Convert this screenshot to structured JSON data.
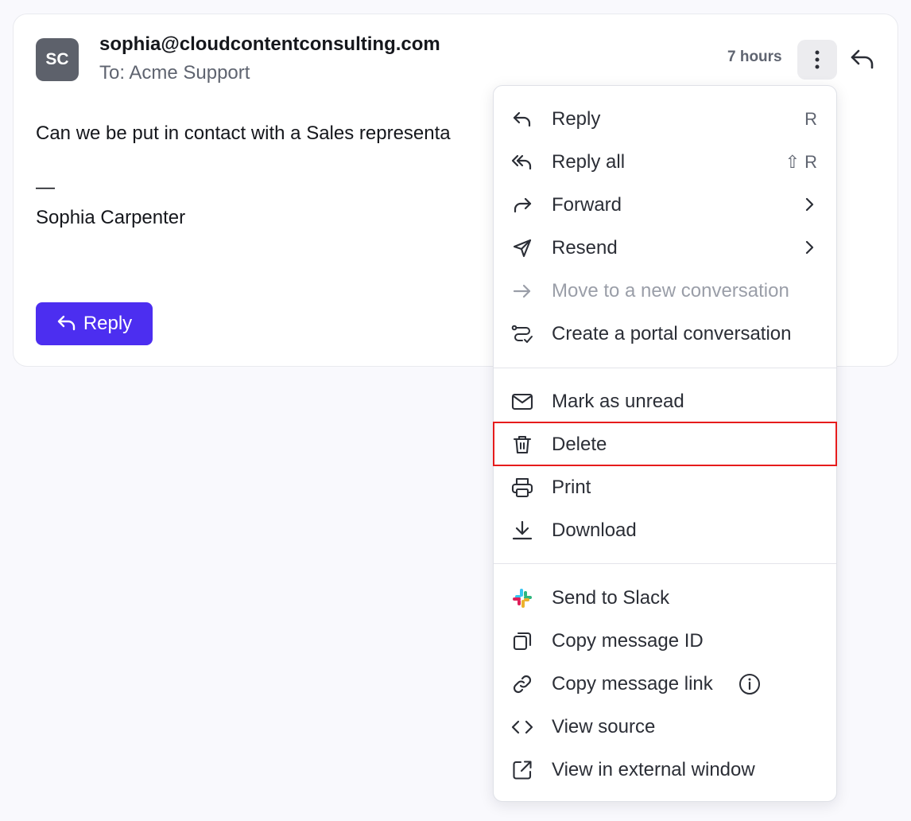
{
  "message": {
    "avatar_initials": "SC",
    "from": "sophia@cloudcontentconsulting.com",
    "to": "To: Acme Support",
    "time": "7 hours",
    "body": "Can we be put in contact with a Sales representa",
    "sig_dash": "—",
    "sig_name": "Sophia Carpenter",
    "reply_button": "Reply"
  },
  "menu": {
    "items": [
      {
        "label": "Reply",
        "shortcut": "R",
        "icon": "reply-icon"
      },
      {
        "label": "Reply all",
        "shortcut": "R",
        "shortcut_modifier": "⇧",
        "icon": "reply-all-icon"
      },
      {
        "label": "Forward",
        "icon": "forward-icon"
      },
      {
        "label": "Resend",
        "icon": "send-icon"
      },
      {
        "label": "Move to a new conversation",
        "icon": "arrow-right-icon",
        "disabled": true
      },
      {
        "label": "Create a portal conversation",
        "icon": "portal-icon"
      },
      {
        "label": "Mark as unread",
        "icon": "envelope-icon"
      },
      {
        "label": "Delete",
        "icon": "trash-icon"
      },
      {
        "label": "Print",
        "icon": "printer-icon"
      },
      {
        "label": "Download",
        "icon": "download-icon"
      },
      {
        "label": "Send to Slack",
        "icon": "slack-icon"
      },
      {
        "label": "Copy message ID",
        "icon": "copy-icon"
      },
      {
        "label": "Copy message link",
        "icon": "link-icon"
      },
      {
        "label": "View source",
        "icon": "code-icon"
      },
      {
        "label": "View in external window",
        "icon": "external-window-icon"
      }
    ]
  },
  "colors": {
    "accent": "#4c2ef0",
    "highlight": "#e61c1c",
    "avatar_bg": "#5d616b"
  }
}
